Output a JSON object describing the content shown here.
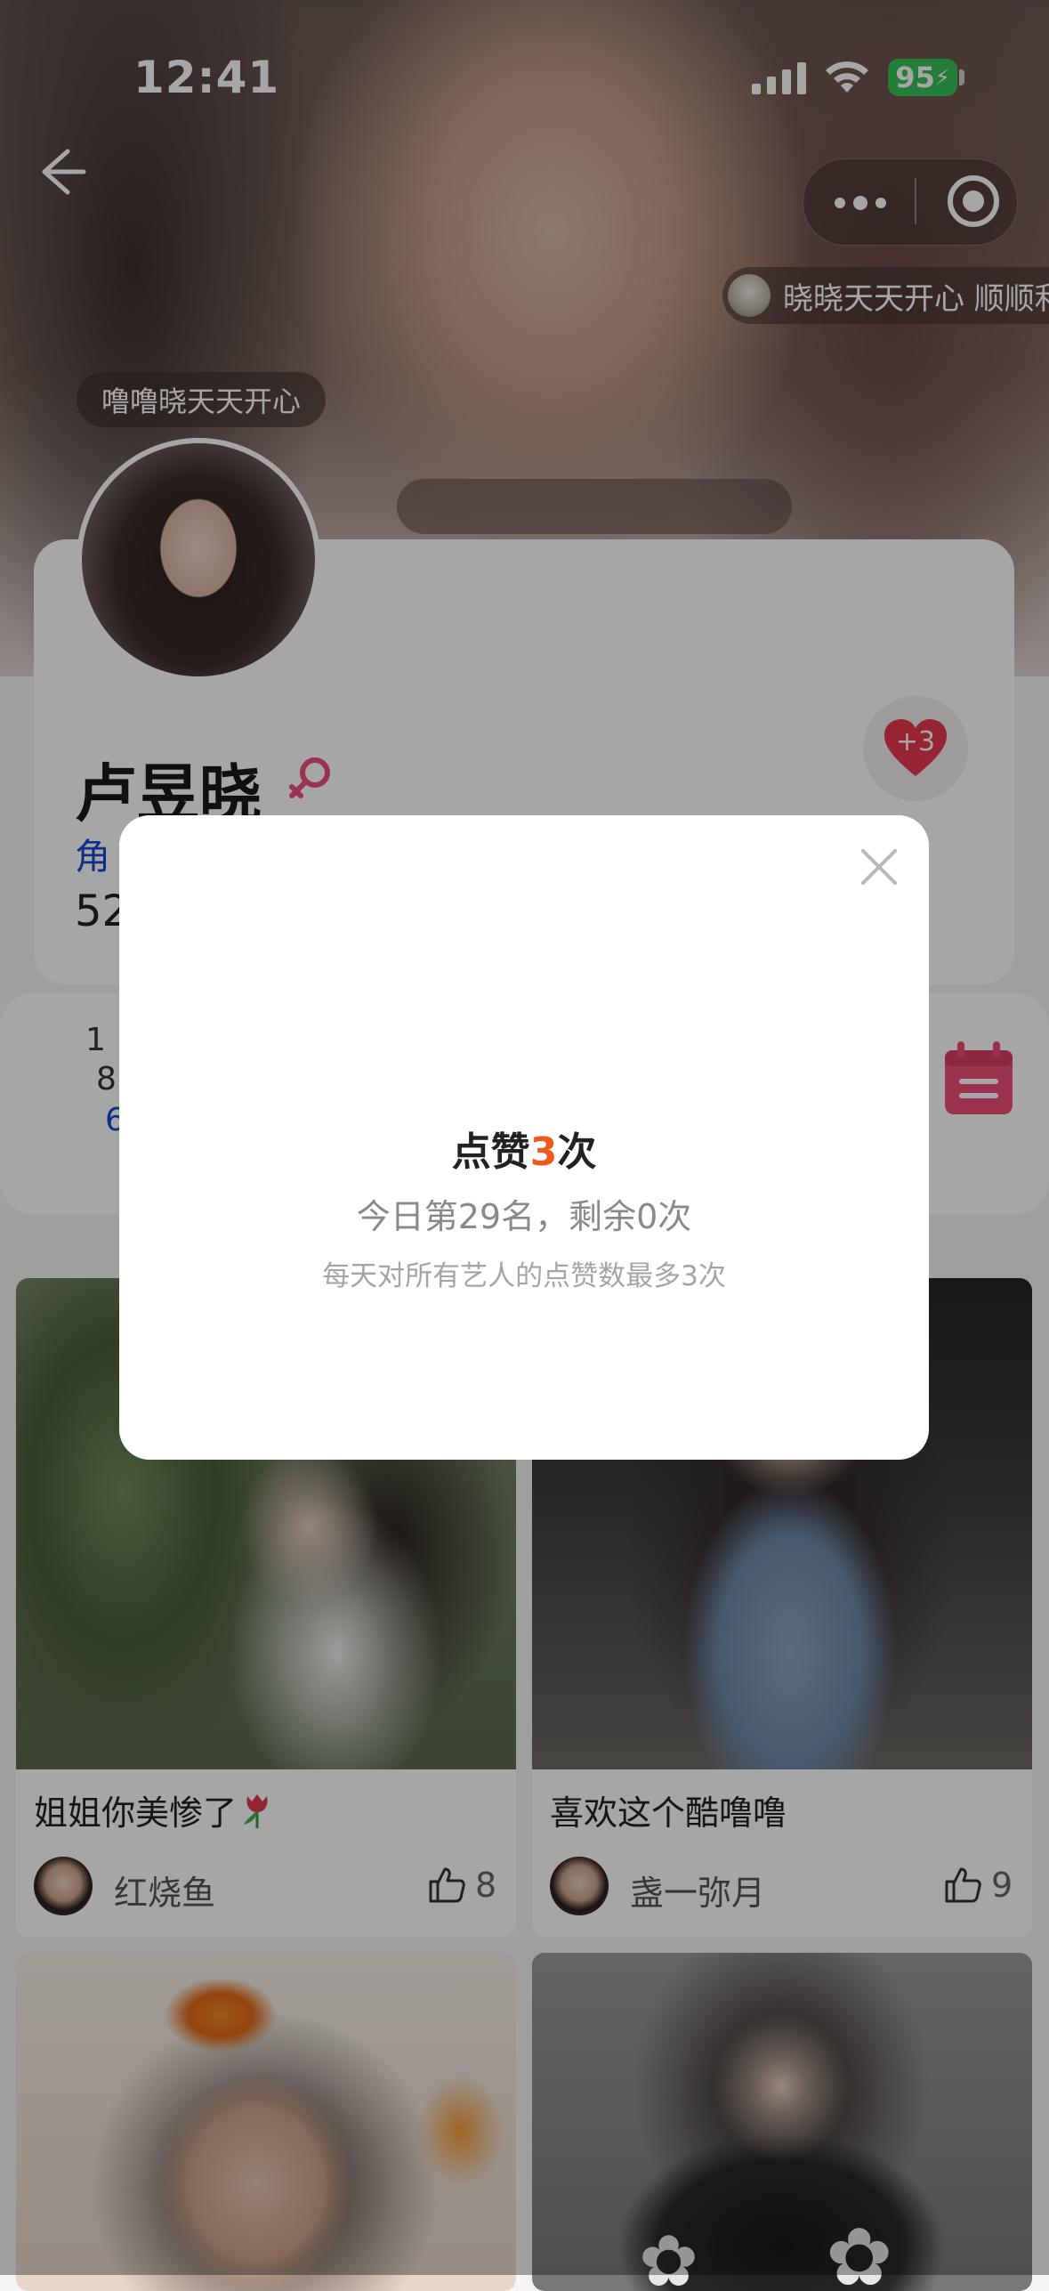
{
  "status_bar": {
    "time": "12:41",
    "battery": "95"
  },
  "ticker": {
    "text": "晓晓天天开心 顺顺利"
  },
  "fan_tag": "噜噜晓天天开心",
  "profile": {
    "name": "卢昱晓",
    "role_partial": "角",
    "number_partial": "52",
    "like_badge": "+3"
  },
  "stats": {
    "a": "1",
    "b": "8",
    "c": "6"
  },
  "feed": [
    {
      "title": "姐姐你美惨了",
      "author": "红烧鱼",
      "likes": "8"
    },
    {
      "title": "喜欢这个酷噜噜",
      "author": "盏一弥月",
      "likes": "9"
    }
  ],
  "modal": {
    "title_prefix": "点赞",
    "title_count": "3",
    "title_suffix": "次",
    "subtitle": "今日第29名，剩余0次",
    "note": "每天对所有艺人的点赞数最多3次"
  },
  "colors": {
    "accent": "#f05a1e",
    "link_blue": "#1a46d6",
    "heart_red": "#e8384f",
    "calendar_pink": "#ee4f78"
  }
}
